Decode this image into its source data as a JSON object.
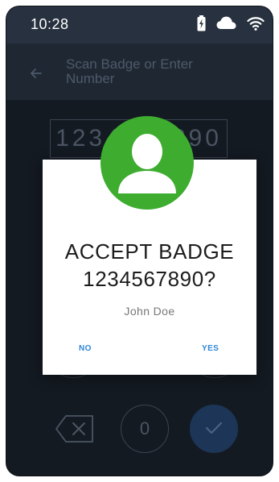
{
  "status_bar": {
    "time": "10:28",
    "icons": [
      "battery-charging-icon",
      "cloud-icon",
      "wifi-icon"
    ]
  },
  "app_bar": {
    "back_icon": "arrow-left-icon",
    "title": "Scan Badge or Enter Number"
  },
  "badge_input": {
    "value": "1234567890"
  },
  "keypad": {
    "backspace_icon": "backspace-icon",
    "zero_label": "0",
    "confirm_icon": "checkmark-icon"
  },
  "dialog": {
    "avatar_icon": "user-avatar-icon",
    "title_line1": "ACCEPT BADGE",
    "title_line2": "1234567890?",
    "name": "John Doe",
    "no_label": "NO",
    "yes_label": "YES"
  },
  "colors": {
    "accent_green": "#3dac2f",
    "link_blue": "#2e86d6",
    "confirm_blue": "#1d3556",
    "status_bar_bg": "#27313f",
    "screen_bg": "#141a22"
  }
}
